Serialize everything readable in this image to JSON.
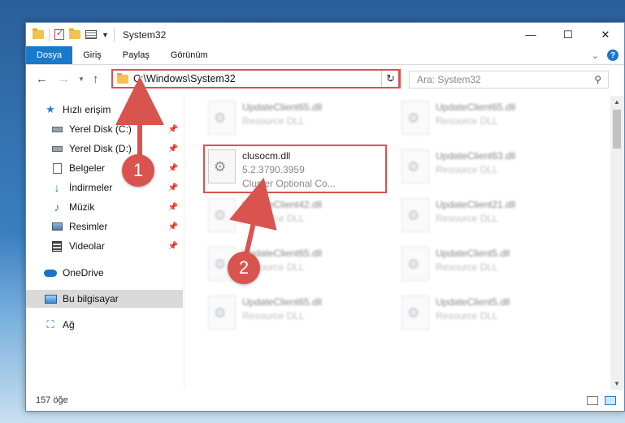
{
  "window": {
    "title": "System32",
    "controls": {
      "minimize": "—",
      "maximize": "☐",
      "close": "✕"
    }
  },
  "ribbon": {
    "tabs": [
      {
        "label": "Dosya",
        "active": true
      },
      {
        "label": "Giriş"
      },
      {
        "label": "Paylaş"
      },
      {
        "label": "Görünüm"
      }
    ],
    "help_label": "?"
  },
  "navbar": {
    "address": "C:\\Windows\\System32",
    "search_placeholder": "Ara: System32"
  },
  "sidebar": {
    "items": [
      {
        "label": "Hızlı erişim",
        "icon": "star-icon"
      },
      {
        "label": "Yerel Disk (C:)",
        "icon": "drive-icon",
        "pinned": true
      },
      {
        "label": "Yerel Disk (D:)",
        "icon": "drive-icon",
        "pinned": true
      },
      {
        "label": "Belgeler",
        "icon": "document-icon",
        "pinned": true
      },
      {
        "label": "İndirmeler",
        "icon": "download-icon",
        "pinned": true
      },
      {
        "label": "Müzik",
        "icon": "music-icon",
        "pinned": true
      },
      {
        "label": "Resimler",
        "icon": "pictures-icon",
        "pinned": true
      },
      {
        "label": "Videolar",
        "icon": "video-icon",
        "pinned": true
      },
      {
        "label": "OneDrive",
        "icon": "onedrive-icon"
      },
      {
        "label": "Bu bilgisayar",
        "icon": "computer-icon",
        "selected": true
      },
      {
        "label": "Ağ",
        "icon": "network-icon"
      }
    ]
  },
  "files": [
    {
      "name": "UpdateClient65.dll",
      "sub": "Resource DLL",
      "blurred": true
    },
    {
      "name": "UpdateClient65.dll",
      "sub": "Resource DLL",
      "blurred": true
    },
    {
      "name": "clusocm.dll",
      "version": "5.2.3790.3959",
      "sub": "Cluster Optional Co...",
      "highlighted": true
    },
    {
      "name": "UpdateClient63.dll",
      "sub": "Resource DLL",
      "blurred": true
    },
    {
      "name": "UpdateClient42.dll",
      "sub": "Resource DLL",
      "blurred": true
    },
    {
      "name": "UpdateClient21.dll",
      "sub": "Resource DLL",
      "blurred": true
    },
    {
      "name": "UpdateClient65.dll",
      "sub": "Resource DLL",
      "blurred": true
    },
    {
      "name": "UpdateClient5.dll",
      "sub": "Resource DLL",
      "blurred": true
    },
    {
      "name": "UpdateClient65.dll",
      "sub": "Resource DLL",
      "blurred": true
    },
    {
      "name": "UpdateClient5.dll",
      "sub": "Resource DLL",
      "blurred": true
    }
  ],
  "status": {
    "count": "157 öğe"
  },
  "annotations": {
    "step1": "1",
    "step2": "2",
    "color": "#d9534f"
  }
}
